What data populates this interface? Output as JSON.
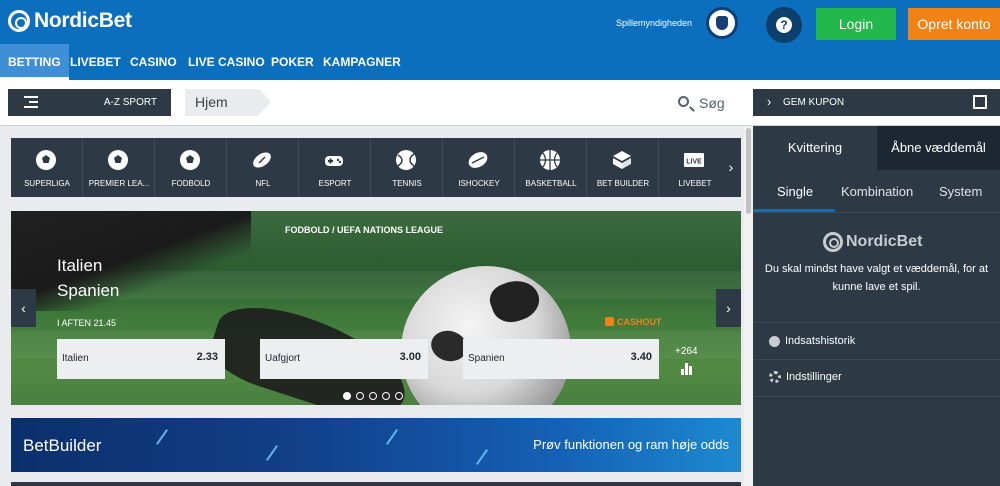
{
  "header": {
    "brand": "NordicBet",
    "regulator": "Spillemyndigheden",
    "help": "?",
    "login": "Login",
    "signup": "Opret konto"
  },
  "nav": [
    {
      "label": "BETTING",
      "active": true
    },
    {
      "label": "LIVEBET"
    },
    {
      "label": "CASINO"
    },
    {
      "label": "LIVE CASINO"
    },
    {
      "label": "POKER"
    },
    {
      "label": "KAMPAGNER"
    }
  ],
  "subbar": {
    "az_sport": "A-Z SPORT",
    "breadcrumb": "Hjem",
    "search": "Søg",
    "coupon": "GEM KUPON"
  },
  "sports": [
    {
      "label": "SUPERLIGA",
      "icon": "football-icon"
    },
    {
      "label": "PREMIER LEA...",
      "icon": "football-icon"
    },
    {
      "label": "FODBOLD",
      "icon": "football-icon"
    },
    {
      "label": "NFL",
      "icon": "american-football-icon"
    },
    {
      "label": "ESPORT",
      "icon": "gamepad-icon"
    },
    {
      "label": "TENNIS",
      "icon": "tennis-ball-icon"
    },
    {
      "label": "ISHOCKEY",
      "icon": "hockey-puck-icon"
    },
    {
      "label": "BASKETBALL",
      "icon": "basketball-icon"
    },
    {
      "label": "BET BUILDER",
      "icon": "bet-builder-icon"
    },
    {
      "label": "LIVEBET",
      "icon": "live-icon",
      "badge": "LIVE"
    }
  ],
  "banner": {
    "league": "FODBOLD / UEFA NATIONS LEAGUE",
    "home": "Italien",
    "away": "Spanien",
    "time": "I AFTEN 21.45",
    "cashout": "CASHOUT",
    "odds": [
      {
        "name": "Italien",
        "value": "2.33"
      },
      {
        "name": "Uafgjort",
        "value": "3.00"
      },
      {
        "name": "Spanien",
        "value": "3.40"
      }
    ],
    "more": "+264",
    "slides": 5,
    "active_slide": 1
  },
  "betbuilder": {
    "title": "BetBuilder",
    "subtitle": "Prøv funktionen og ram høje odds"
  },
  "betslip": {
    "tabs": [
      "Kvittering",
      "Åbne væddemål"
    ],
    "subtabs": [
      "Single",
      "Kombination",
      "System"
    ],
    "brand": "NordicBet",
    "message": "Du skal mindst have valgt et væddemål, for at kunne lave et spil.",
    "links": [
      "Indsatshistorik",
      "Indstillinger"
    ]
  },
  "colors": {
    "brand_blue": "#0b6fbd",
    "dark_panel": "#2d3a46",
    "login_green": "#22b84b",
    "signup_orange": "#f18316"
  }
}
